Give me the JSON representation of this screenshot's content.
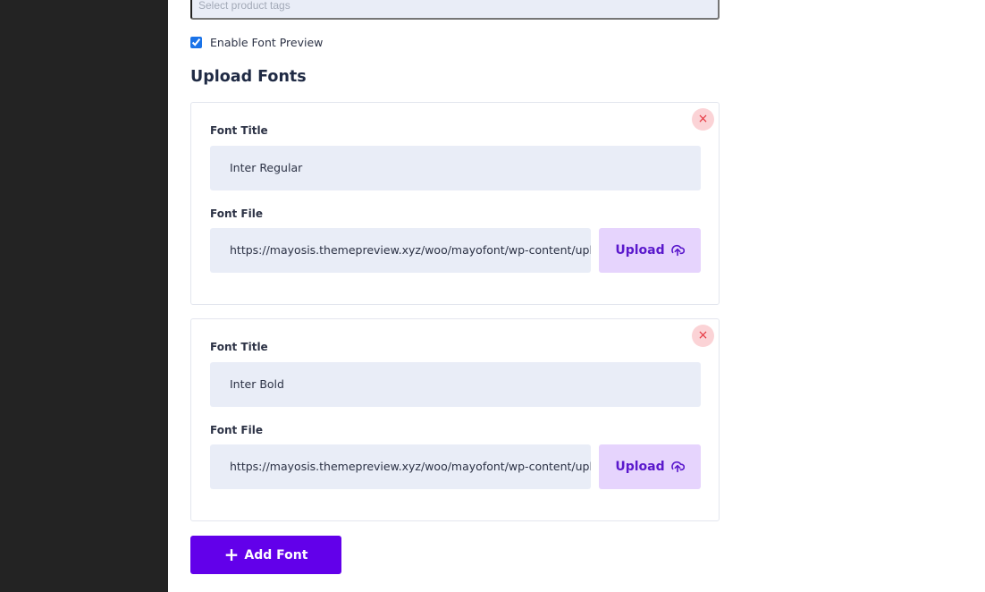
{
  "form": {
    "tags_placeholder": "Select product tags",
    "font_preview_label": "Enable Font Preview",
    "font_preview_checked": true,
    "section_title": "Upload Fonts"
  },
  "fonts": [
    {
      "title_label": "Font Title",
      "title_value": "Inter Regular",
      "file_label": "Font File",
      "file_value": "https://mayosis.themepreview.xyz/woo/mayofont/wp-content/uploads/",
      "upload_label": "Upload",
      "remove_icon": "×"
    },
    {
      "title_label": "Font Title",
      "title_value": "Inter Bold",
      "file_label": "Font File",
      "file_value": "https://mayosis.themepreview.xyz/woo/mayofont/wp-content/uploads/",
      "upload_label": "Upload",
      "remove_icon": "×"
    }
  ],
  "add_font": {
    "icon": "+",
    "label": "Add Font"
  },
  "colors": {
    "sidebar": "#232323",
    "field_bg": "#e9edf7",
    "upload_bg": "#e6d4fd",
    "upload_text": "#5a18cc",
    "primary": "#6200ea",
    "remove_bg": "#fbd3d6",
    "remove_icon": "#e5343e"
  },
  "icons": {
    "remove": "close-icon",
    "upload": "cloud-upload-icon",
    "add": "plus-icon"
  }
}
